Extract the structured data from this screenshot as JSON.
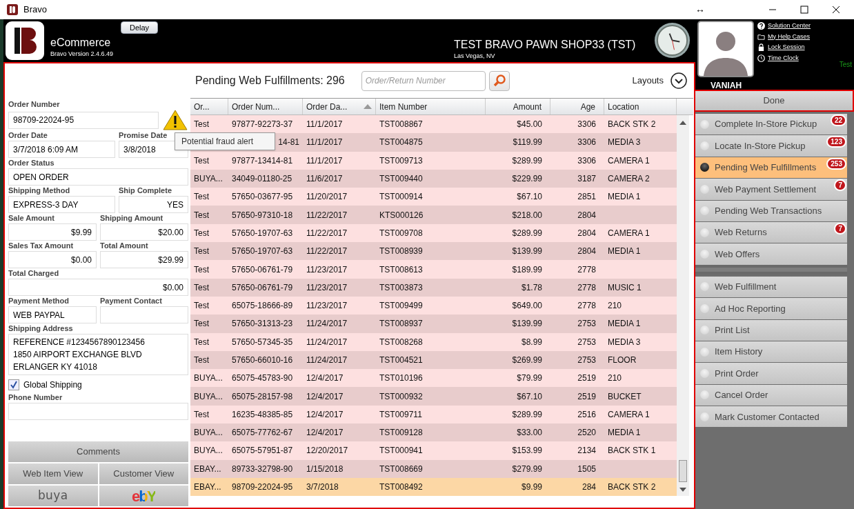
{
  "window": {
    "title": "Bravo",
    "resize_glyph": "↔"
  },
  "header": {
    "delay_button": "Delay",
    "app_name": "eCommerce",
    "version": "Bravo Version 2.4.6.49",
    "store_name": "TEST BRAVO PAWN SHOP33 (TST)",
    "store_location": "Las Vegas, NV",
    "user_name": "VANIAH",
    "env_label": "Test",
    "links": [
      {
        "kind": "help",
        "label": "Solution Center"
      },
      {
        "kind": "folder",
        "label": "My Help Cases"
      },
      {
        "kind": "lock",
        "label": "Lock Session"
      },
      {
        "kind": "clock",
        "label": "Time Clock"
      }
    ]
  },
  "form": {
    "rows": [
      [
        {
          "label": "Order Number",
          "value": "98709-22024-95"
        }
      ],
      [
        {
          "label": "Order Date",
          "value": "3/7/2018 6:09 AM"
        },
        {
          "label": "Promise Date",
          "value": "3/8/2018"
        }
      ],
      [
        {
          "label": "Order Status",
          "value": "OPEN ORDER"
        }
      ],
      [
        {
          "label": "Shipping Method",
          "value": "EXPRESS-3 DAY"
        },
        {
          "label": "Ship Complete",
          "value": "YES"
        }
      ],
      [
        {
          "label": "Sale Amount",
          "value": "$9.99"
        },
        {
          "label": "Shipping Amount",
          "value": "$20.00"
        }
      ],
      [
        {
          "label": "Sales Tax Amount",
          "value": "$0.00"
        },
        {
          "label": "Total Amount",
          "value": "$29.99"
        }
      ],
      [
        {
          "label": "Total Charged",
          "value": "$0.00"
        }
      ],
      [
        {
          "label": "Payment Method",
          "value": "WEB PAYPAL"
        },
        {
          "label": "Payment Contact"
        }
      ],
      [
        {
          "label": "Shipping Address",
          "lines": [
            "REFERENCE #1234567890123456",
            "1850 AIRPORT EXCHANGE BLVD",
            "ERLANGER KY 41018"
          ]
        }
      ]
    ],
    "global_shipping": {
      "label": "Global Shipping",
      "checked": true
    },
    "phone": {
      "label": "Phone Number"
    },
    "fraud_alert": true,
    "buttons": {
      "comments": "Comments",
      "web_item_view": "Web Item View",
      "customer_view": "Customer View",
      "buya": "buya",
      "ebay": "ebY"
    }
  },
  "tooltip": "Potential fraud alert",
  "toolbar": {
    "title": "Pending Web Fulfillments: 296",
    "search_placeholder": "Order/Return Number",
    "layouts": "Layouts"
  },
  "table": {
    "columns": [
      {
        "label": "Or...",
        "sorted": false
      },
      {
        "label": "Order Num...",
        "sorted": false
      },
      {
        "label": "Order Da...",
        "sorted": true
      },
      {
        "label": "Item Number",
        "sorted": false
      },
      {
        "label": "Amount",
        "sorted": false
      },
      {
        "label": "Age",
        "sorted": false
      },
      {
        "label": "Location",
        "sorted": false
      }
    ],
    "rows": [
      {
        "cells": [
          "Test",
          "97877-92273-37",
          "11/1/2017",
          "TST008867",
          "$45.00",
          "3306",
          "BACK STK 2"
        ],
        "selected": false
      },
      {
        "cells": [
          "",
          "14-81",
          "11/1/2017",
          "TST004875",
          "$119.99",
          "3306",
          "MEDIA 3"
        ],
        "selected": false
      },
      {
        "cells": [
          "Test",
          "97877-13414-81",
          "11/1/2017",
          "TST009713",
          "$289.99",
          "3306",
          "CAMERA 1"
        ],
        "selected": false
      },
      {
        "cells": [
          "BUYA...",
          "34049-01180-25",
          "11/6/2017",
          "TST009440",
          "$229.99",
          "3187",
          "CAMERA 2"
        ],
        "selected": false
      },
      {
        "cells": [
          "Test",
          "57650-03677-95",
          "11/20/2017",
          "TST000914",
          "$67.10",
          "2851",
          "MEDIA 1"
        ],
        "selected": false
      },
      {
        "cells": [
          "Test",
          "57650-97310-18",
          "11/22/2017",
          "KTS000126",
          "$218.00",
          "2804",
          ""
        ],
        "selected": false
      },
      {
        "cells": [
          "Test",
          "57650-19707-63",
          "11/22/2017",
          "TST009708",
          "$289.99",
          "2804",
          "CAMERA 1"
        ],
        "selected": false
      },
      {
        "cells": [
          "Test",
          "57650-19707-63",
          "11/22/2017",
          "TST008939",
          "$139.99",
          "2804",
          "MEDIA 1"
        ],
        "selected": false
      },
      {
        "cells": [
          "Test",
          "57650-06761-79",
          "11/23/2017",
          "TST008613",
          "$189.99",
          "2778",
          ""
        ],
        "selected": false
      },
      {
        "cells": [
          "Test",
          "57650-06761-79",
          "11/23/2017",
          "TST003873",
          "$1.78",
          "2778",
          "MUSIC 1"
        ],
        "selected": false
      },
      {
        "cells": [
          "Test",
          "65075-18666-89",
          "11/23/2017",
          "TST009499",
          "$649.00",
          "2778",
          "210"
        ],
        "selected": false
      },
      {
        "cells": [
          "Test",
          "57650-31313-23",
          "11/24/2017",
          "TST008937",
          "$139.99",
          "2753",
          "MEDIA 1"
        ],
        "selected": false
      },
      {
        "cells": [
          "Test",
          "57650-57345-35",
          "11/24/2017",
          "TST008268",
          "$8.99",
          "2753",
          "MEDIA 3"
        ],
        "selected": false
      },
      {
        "cells": [
          "Test",
          "57650-66010-16",
          "11/24/2017",
          "TST004521",
          "$269.99",
          "2753",
          "FLOOR"
        ],
        "selected": false
      },
      {
        "cells": [
          "BUYA...",
          "65075-45783-90",
          "12/4/2017",
          "TST010196",
          "$79.99",
          "2519",
          "210"
        ],
        "selected": false
      },
      {
        "cells": [
          "BUYA...",
          "65075-28157-98",
          "12/4/2017",
          "TST000932",
          "$67.10",
          "2519",
          "BUCKET"
        ],
        "selected": false
      },
      {
        "cells": [
          "Test",
          "16235-48385-85",
          "12/4/2017",
          "TST009711",
          "$289.99",
          "2516",
          "CAMERA 1"
        ],
        "selected": false
      },
      {
        "cells": [
          "BUYA...",
          "65075-77762-67",
          "12/4/2017",
          "TST009128",
          "$33.00",
          "2520",
          "MEDIA 1"
        ],
        "selected": false
      },
      {
        "cells": [
          "BUYA...",
          "65075-57951-87",
          "12/20/2017",
          "TST000941",
          "$153.99",
          "2134",
          "BACK STK 1"
        ],
        "selected": false
      },
      {
        "cells": [
          "EBAY...",
          "89733-32798-90",
          "1/15/2018",
          "TST008669",
          "$279.99",
          "1505",
          ""
        ],
        "selected": false
      },
      {
        "cells": [
          "EBAY...",
          "98709-22024-95",
          "3/7/2018",
          "TST008492",
          "$9.99",
          "284",
          "BACK STK 2"
        ],
        "selected": true
      }
    ]
  },
  "done_button": "Done",
  "nav": {
    "groups": [
      [
        {
          "label": "Complete In-Store Pickup",
          "selected": false,
          "badge": "22"
        },
        {
          "label": "Locate In-Store Pickup",
          "selected": false,
          "badge": "123"
        },
        {
          "label": "Pending Web Fulfillments",
          "selected": true,
          "badge": "253"
        },
        {
          "label": "Web Payment Settlement",
          "selected": false,
          "badge": "7"
        },
        {
          "label": "Pending Web Transactions",
          "selected": false
        },
        {
          "label": "Web Returns",
          "selected": false,
          "badge": "7"
        },
        {
          "label": "Web Offers",
          "selected": false
        }
      ],
      [
        {
          "label": "Web Fulfillment",
          "selected": false
        },
        {
          "label": "Ad Hoc Reporting",
          "selected": false
        },
        {
          "label": "Print List",
          "selected": false
        },
        {
          "label": "Item History",
          "selected": false
        },
        {
          "label": "Print Order",
          "selected": false
        },
        {
          "label": "Cancel Order",
          "selected": false
        },
        {
          "label": "Mark Customer Contacted",
          "selected": false
        }
      ]
    ]
  }
}
